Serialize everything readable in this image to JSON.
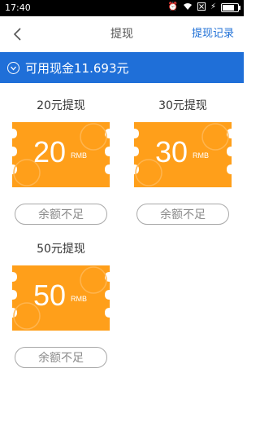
{
  "status_bar": {
    "time": "17:40",
    "icons": [
      "alarm-icon",
      "wifi-icon",
      "sim-x-icon",
      "charging-icon",
      "battery-icon"
    ]
  },
  "header": {
    "title": "提现",
    "action_label": "提现记录",
    "back_icon": "chevron-left-icon"
  },
  "balance": {
    "icon": "coin-icon",
    "text": "可用现金11.693元"
  },
  "colors": {
    "primary_blue": "#1f6fd8",
    "coupon_orange": "#ff9f1a",
    "disabled_gray": "#a8a8a8"
  },
  "options": [
    {
      "title": "20元提现",
      "amount": "20",
      "unit": "RMB",
      "button": "余额不足"
    },
    {
      "title": "30元提现",
      "amount": "30",
      "unit": "RMB",
      "button": "余额不足"
    },
    {
      "title": "50元提现",
      "amount": "50",
      "unit": "RMB",
      "button": "余额不足"
    }
  ]
}
